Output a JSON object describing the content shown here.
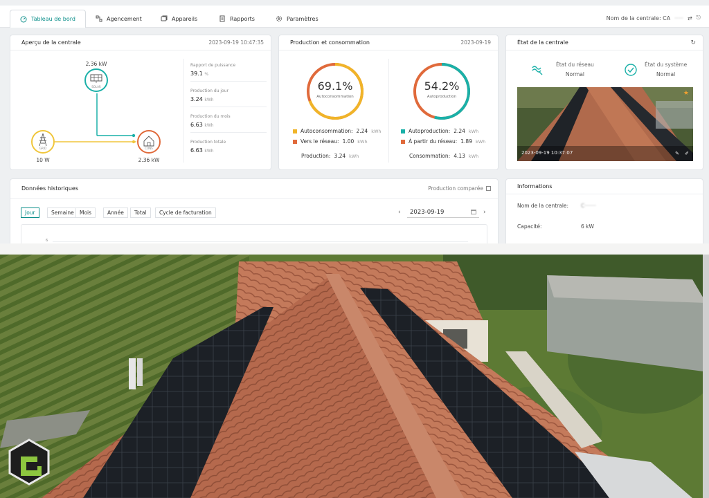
{
  "nav": {
    "tabs": [
      {
        "label": "Tableau de bord",
        "icon": "dashboard-icon",
        "active": true
      },
      {
        "label": "Agencement",
        "icon": "layout-icon"
      },
      {
        "label": "Appareils",
        "icon": "devices-icon"
      },
      {
        "label": "Rapports",
        "icon": "reports-icon"
      },
      {
        "label": "Paramètres",
        "icon": "settings-icon"
      }
    ],
    "plant_label": "Nom de la centrale: CA",
    "plant_name_blurred": "·····"
  },
  "overview": {
    "title": "Aperçu de la centrale",
    "datetime": "2023-09-19 10:47:35",
    "solar_power": "2.36 kW",
    "solar_label": "SOLAR",
    "grid_power": "10 W",
    "grid_label": "GRID",
    "home_power": "2.36 kW",
    "home_label": "CONS",
    "stats": [
      {
        "label": "Rapport de puissance",
        "value": "39.1",
        "unit": "%"
      },
      {
        "label": "Production du jour",
        "value": "3.24",
        "unit": "kWh"
      },
      {
        "label": "Production du mois",
        "value": "6.63",
        "unit": "kWh"
      },
      {
        "label": "Production totale",
        "value": "6.63",
        "unit": "kWh"
      }
    ]
  },
  "production": {
    "title": "Production et consommation",
    "date": "2023-09-19",
    "self_consumption": {
      "pct": "69.1%",
      "fraction": 0.691,
      "sub": "Autoconsommation"
    },
    "self_production": {
      "pct": "54.2%",
      "fraction": 0.542,
      "sub": "Autoproduction"
    },
    "left_legend": [
      {
        "label": "Autoconsommation:",
        "value": "2.24",
        "unit": "kWh",
        "color": "#f0b429"
      },
      {
        "label": "Vers le réseau:",
        "value": "1.00",
        "unit": "kWh",
        "color": "#e06a3b"
      }
    ],
    "left_total": {
      "label": "Production:",
      "value": "3.24",
      "unit": "kWh"
    },
    "right_legend": [
      {
        "label": "Autoproduction:",
        "value": "2.24",
        "unit": "kWh",
        "color": "#1ab0a8"
      },
      {
        "label": "À partir du réseau:",
        "value": "1.89",
        "unit": "kWh",
        "color": "#e06a3b"
      }
    ],
    "right_total": {
      "label": "Consommation:",
      "value": "4.13",
      "unit": "kWh"
    }
  },
  "state": {
    "title": "État de la centrale",
    "network_label": "État du réseau",
    "network_value": "Normal",
    "system_label": "État du système",
    "system_value": "Normal",
    "photo_timestamp": "2023-09-19 10:37:07"
  },
  "history": {
    "title": "Données historiques",
    "compare_label": "Production comparée",
    "ranges": [
      "Jour",
      "Semaine",
      "Mois",
      "Année",
      "Total",
      "Cycle de facturation"
    ],
    "selected_range": "Jour",
    "date": "2023-09-19",
    "y_tick": "6"
  },
  "info": {
    "title": "Informations",
    "name_label": "Nom de la centrale:",
    "name_value_blurred": "C·······",
    "capacity_label": "Capacité:",
    "capacity_value": "6 kW"
  },
  "colors": {
    "accent": "#0b8f8a",
    "solar_ring": "#1ab0a8",
    "grid_ring": "#f0c63c",
    "home_ring": "#e06a3b",
    "flow_line": "#f0c63c"
  }
}
